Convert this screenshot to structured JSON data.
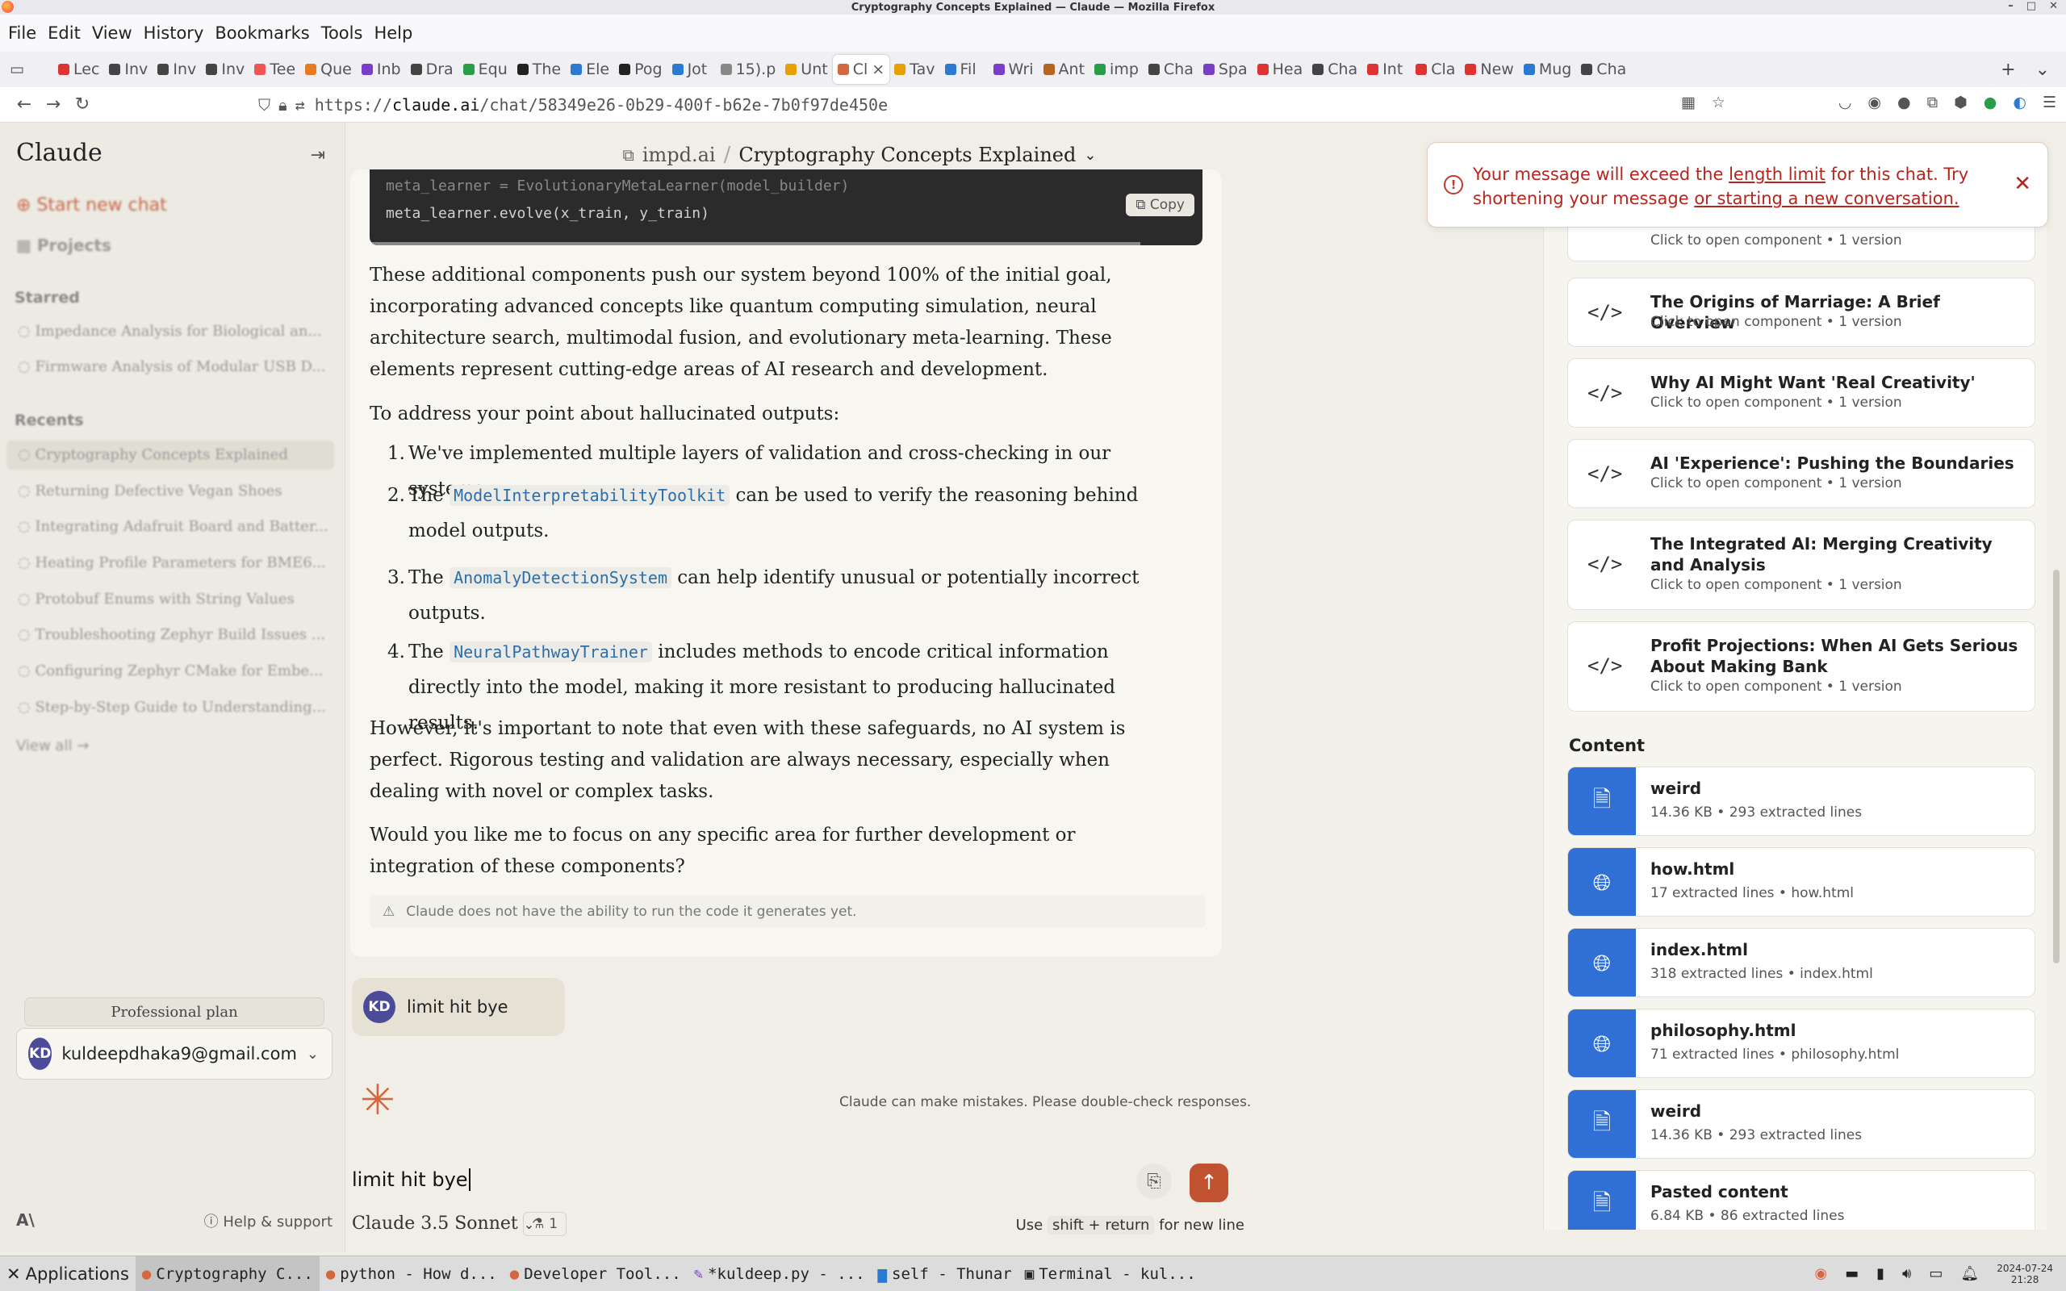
{
  "window": {
    "title": "Cryptography Concepts Explained — Claude — Mozilla Firefox",
    "controls": [
      "–",
      "□",
      "✕"
    ]
  },
  "menubar": [
    "File",
    "Edit",
    "View",
    "History",
    "Bookmarks",
    "Tools",
    "Help"
  ],
  "tabs": [
    {
      "label": "Lec",
      "color": "#d33"
    },
    {
      "label": "Inv",
      "color": "#444"
    },
    {
      "label": "Inv",
      "color": "#444"
    },
    {
      "label": "Inv",
      "color": "#444"
    },
    {
      "label": "Tee",
      "color": "#e55"
    },
    {
      "label": "Que",
      "color": "#e77b22"
    },
    {
      "label": "Inb",
      "color": "#7a3fc7"
    },
    {
      "label": "Dra",
      "color": "#444"
    },
    {
      "label": "Equ",
      "color": "#2a9d4a"
    },
    {
      "label": "The",
      "color": "#222"
    },
    {
      "label": "Ele",
      "color": "#2a7ad2"
    },
    {
      "label": "Pog",
      "color": "#222"
    },
    {
      "label": "Jot",
      "color": "#2a7ad2"
    },
    {
      "label": "15).p",
      "color": "#888"
    },
    {
      "label": "Unt",
      "color": "#e6a000"
    },
    {
      "label": "Cl",
      "color": "#d4673f",
      "active": true
    },
    {
      "label": "Tav",
      "color": "#e6a000"
    },
    {
      "label": "Fil",
      "color": "#2a7ad2"
    },
    {
      "label": "Wri",
      "color": "#7a3fc7"
    },
    {
      "label": "Ant",
      "color": "#b5651d"
    },
    {
      "label": "imp",
      "color": "#2a9d4a"
    },
    {
      "label": "Cha",
      "color": "#444"
    },
    {
      "label": "Spa",
      "color": "#7a3fc7"
    },
    {
      "label": "Hea",
      "color": "#d33"
    },
    {
      "label": "Cha",
      "color": "#444"
    },
    {
      "label": "Int",
      "color": "#d33"
    },
    {
      "label": "Cla",
      "color": "#d33"
    },
    {
      "label": "New",
      "color": "#d33"
    },
    {
      "label": "Mug",
      "color": "#2a7ad2"
    },
    {
      "label": "Cha",
      "color": "#444"
    }
  ],
  "url": {
    "prefix": "https://",
    "host": "claude.ai",
    "path": "/chat/58349e26-0b29-400f-b62e-7b0f97de450e"
  },
  "sidebar": {
    "brand": "Claude",
    "start_new_chat": "Start new chat",
    "projects": "Projects",
    "starred_header": "Starred",
    "starred": [
      "Impedance Analysis for Biological an...",
      "Firmware Analysis of Modular USB D..."
    ],
    "recents_header": "Recents",
    "recents": [
      "Cryptography Concepts Explained",
      "Returning Defective Vegan Shoes",
      "Integrating Adafruit Board and Batter...",
      "Heating Profile Parameters for BME6...",
      "Protobuf Enums with String Values",
      "Troubleshooting Zephyr Build Issues ...",
      "Configuring Zephyr CMake for Embe...",
      "Step-by-Step Guide to Understanding..."
    ],
    "view_all": "View all →",
    "plan": "Professional plan",
    "avatar": "KD",
    "email": "kuldeepdhaka9@gmail.com",
    "help": "Help & support"
  },
  "header": {
    "project": "impd.ai",
    "separator": "/",
    "title": "Cryptography Concepts Explained"
  },
  "code": {
    "line1": "meta_learner = EvolutionaryMetaLearner(model_builder)",
    "line2": "meta_learner.evolve(x_train, y_train)",
    "copy": "Copy"
  },
  "response": {
    "p1": "These additional components push our system beyond 100% of the initial goal, incorporating advanced concepts like quantum computing simulation, neural architecture search, multimodal fusion, and evolutionary meta-learning. These elements represent cutting-edge areas of AI research and development.",
    "p2": "To address your point about hallucinated outputs:",
    "items": [
      {
        "num": "1.",
        "pre": "We've implemented multiple layers of validation and cross-checking in our systems.",
        "code": "",
        "post": ""
      },
      {
        "num": "2.",
        "pre": "The ",
        "code": "ModelInterpretabilityToolkit",
        "post": " can be used to verify the reasoning behind model outputs."
      },
      {
        "num": "3.",
        "pre": "The ",
        "code": "AnomalyDetectionSystem",
        "post": " can help identify unusual or potentially incorrect outputs."
      },
      {
        "num": "4.",
        "pre": "The ",
        "code": "NeuralPathwayTrainer",
        "post": " includes methods to encode critical information directly into the model, making it more resistant to producing hallucinated results."
      }
    ],
    "p3": "However, it's important to note that even with these safeguards, no AI system is perfect. Rigorous testing and validation are always necessary, especially when dealing with novel or complex tasks.",
    "p4": "Would you like me to focus on any specific area for further development or integration of these components?",
    "warning": "Claude does not have the ability to run the code it generates yet."
  },
  "user_message": {
    "avatar": "KD",
    "text": "limit hit bye"
  },
  "disclaimer": "Claude can make mistakes. Please double-check responses.",
  "composer": {
    "value": "limit hit bye",
    "model": "Claude 3.5 Sonnet",
    "badge": "1",
    "hint_pre": "Use",
    "hint_key": "shift + return",
    "hint_post": "for new line"
  },
  "toast": {
    "pre": "Your message will exceed the",
    "link1": "length limit",
    "mid": "for this chat. Try shortening your message",
    "link2": "or starting a new conversation."
  },
  "artifacts": [
    {
      "title": "",
      "sub": "Click to open component • 1 version"
    },
    {
      "title": "The Origins of Marriage: A Brief Overview",
      "sub": "Click to open component • 1 version"
    },
    {
      "title": "Why AI Might Want 'Real Creativity'",
      "sub": "Click to open component • 1 version"
    },
    {
      "title": "AI 'Experience': Pushing the Boundaries",
      "sub": "Click to open component • 1 version"
    },
    {
      "title": "The Integrated AI: Merging Creativity and Analysis",
      "sub": "Click to open component • 1 version"
    },
    {
      "title": "Profit Projections: When AI Gets Serious About Making Bank",
      "sub": "Click to open component • 1 version"
    }
  ],
  "content_header": "Content",
  "content": [
    {
      "title": "weird",
      "sub": "14.36 KB • 293 extracted lines",
      "icon": "document-icon"
    },
    {
      "title": "how.html",
      "sub": "17 extracted lines • how.html",
      "icon": "globe-icon"
    },
    {
      "title": "index.html",
      "sub": "318 extracted lines • index.html",
      "icon": "globe-icon"
    },
    {
      "title": "philosophy.html",
      "sub": "71 extracted lines • philosophy.html",
      "icon": "globe-icon"
    },
    {
      "title": "weird",
      "sub": "14.36 KB • 293 extracted lines",
      "icon": "document-icon"
    },
    {
      "title": "Pasted content",
      "sub": "6.84 KB • 86 extracted lines",
      "icon": "document-icon"
    }
  ],
  "taskbar": {
    "apps": "Applications",
    "tasks": [
      "Cryptography C...",
      "python - How d...",
      "Developer Tool...",
      "*kuldeep.py - ...",
      "self - Thunar",
      "Terminal - kul..."
    ],
    "date": "2024-07-24",
    "time": "21:28"
  },
  "colors": {
    "accent": "#c0522f",
    "toast": "#b3261e",
    "content_icon": "#2f6fd6"
  }
}
